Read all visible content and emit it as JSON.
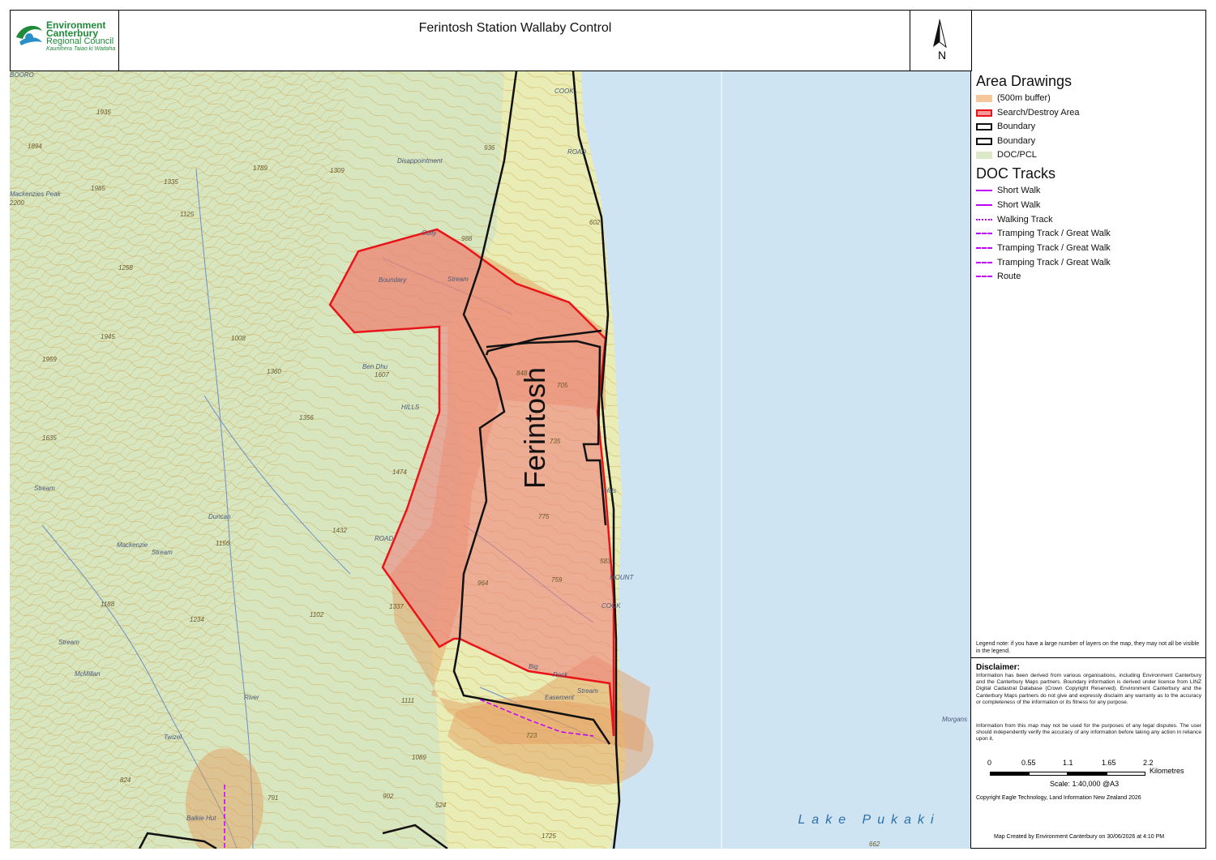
{
  "header": {
    "org_line1": "Environment",
    "org_line2": "Canterbury",
    "org_line3": "Regional Council",
    "org_line4": "Kaunihera Taiao ki Waitaha",
    "title": "Ferintosh Station Wallaby Control",
    "north_label": "N"
  },
  "map": {
    "area_label": "Ferintosh",
    "lake_label": "Lake  Pukaki",
    "place_labels": [
      "Mackenzies Peak",
      "2200",
      "1985",
      "1894",
      "1935",
      "1335",
      "1789",
      "1309",
      "Boundary",
      "Stream",
      "Disappointment",
      "Gully",
      "988",
      "936",
      "602",
      "COOK",
      "ROAD",
      "Ben Dhu",
      "1607",
      "1360",
      "1356",
      "848",
      "705",
      "735",
      "HILLS",
      "1474",
      "1432",
      "775",
      "583",
      "759",
      "964",
      "1337",
      "1102",
      "Big",
      "Rock",
      "Stream",
      "Easement",
      "Morgans",
      "723",
      "1111",
      "1089",
      "902",
      "791",
      "824",
      "Balkie Hut",
      "Twizel",
      "River",
      "Duncan",
      "Stream",
      "Mackenzie",
      "Stream",
      "McMillan",
      "Stream",
      "1188",
      "1234",
      "1156",
      "1008",
      "1125",
      "1258",
      "1945",
      "1959",
      "1635",
      "1725",
      "662",
      "524",
      "Hills",
      "MOUNT",
      "COOK",
      "ROAD",
      "BOORO"
    ]
  },
  "legend": {
    "area_heading": "Area Drawings",
    "area_items": [
      {
        "label": "(500m buffer)",
        "color": "#f5c79a",
        "border": "#f5c79a"
      },
      {
        "label": "Search/Destroy Area",
        "color": "#f49a9a",
        "border": "#e8141a"
      },
      {
        "label": "Boundary",
        "color": "#ffffff",
        "border": "#111111"
      },
      {
        "label": "Boundary",
        "color": "#ffffff",
        "border": "#111111"
      },
      {
        "label": "DOC/PCL",
        "color": "#dbe9c8",
        "border": "#dbe9c8"
      }
    ],
    "doc_heading": "DOC Tracks",
    "doc_items": [
      {
        "label": "Short Walk",
        "style": "solid"
      },
      {
        "label": "Short Walk",
        "style": "solid"
      },
      {
        "label": "Walking Track",
        "style": "dashdot"
      },
      {
        "label": "Tramping Track / Great Walk",
        "style": "dashed"
      },
      {
        "label": "Tramping Track / Great Walk",
        "style": "dashed"
      },
      {
        "label": "Tramping Track / Great Walk",
        "style": "dashed"
      },
      {
        "label": "Route",
        "style": "dashed"
      }
    ],
    "track_color": "#c000ff",
    "note": "Legend note: if you have a large number of layers on the map, they may not all be visible in the legend."
  },
  "disclaimer": {
    "heading": "Disclaimer:",
    "para1": "Information has been derived from various organisations, including Environment Canterbury and the Canterbury Maps partners. Boundary information is derived under licence from LINZ Digital Cadastral Database (Crown Copyright Reserved). Environment Canterbury and the Canterbury Maps partners do not give and expressly disclaim any warranty as to the accuracy or completeness of the information or its fitness for any purpose.",
    "para2": "Information from this map may not be used for the purposes of any legal disputes. The user should independently verify the accuracy of any information before taking any action in reliance upon it."
  },
  "scale": {
    "ticks": [
      "0",
      "0.55",
      "1.1",
      "1.65",
      "2.2"
    ],
    "unit": "Kilometres",
    "text": "Scale: 1:40,000 @A3"
  },
  "copyright": "Copyright Eagle Technology, Land Information New Zealand 2026",
  "created": "Map Created by Environment Canterbury on 30/06/2026 at 4:10 PM",
  "colors": {
    "terrain": "#e9ecb4",
    "doc_land": "#d8e6c0",
    "lake": "#cfe4f3",
    "contour": "#c99a3a",
    "stream": "#6f8fc0",
    "buffer": "#e59a5a",
    "search": "#f07a7a",
    "search_edge": "#e8141a"
  }
}
